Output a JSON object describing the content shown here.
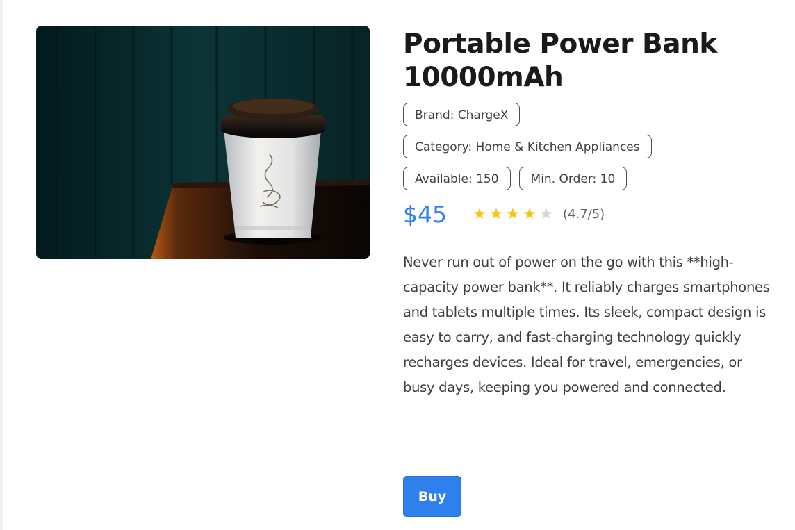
{
  "product": {
    "title": "Portable Power Bank 10000mAh",
    "image_alt": "Paper coffee cup on a wooden table",
    "badges": {
      "brand": "Brand: ChargeX",
      "category": "Category: Home & Kitchen Appliances",
      "available": "Available: 150",
      "min_order": "Min. Order: 10"
    },
    "price": "$45",
    "rating": {
      "stars_full": 4,
      "stars_total": 5,
      "text": "(4.7/5)"
    },
    "description": "Never run out of power on the go with this **high-capacity power bank**. It reliably charges smartphones and tablets multiple times. Its sleek, compact design is easy to carry, and fast-charging technology quickly recharges devices. Ideal for travel, emergencies, or busy days, keeping you powered and connected.",
    "buy_label": "Buy"
  },
  "colors": {
    "accent": "#2f80ed",
    "star_full": "#f5c518",
    "star_empty": "#d3d5d8"
  }
}
